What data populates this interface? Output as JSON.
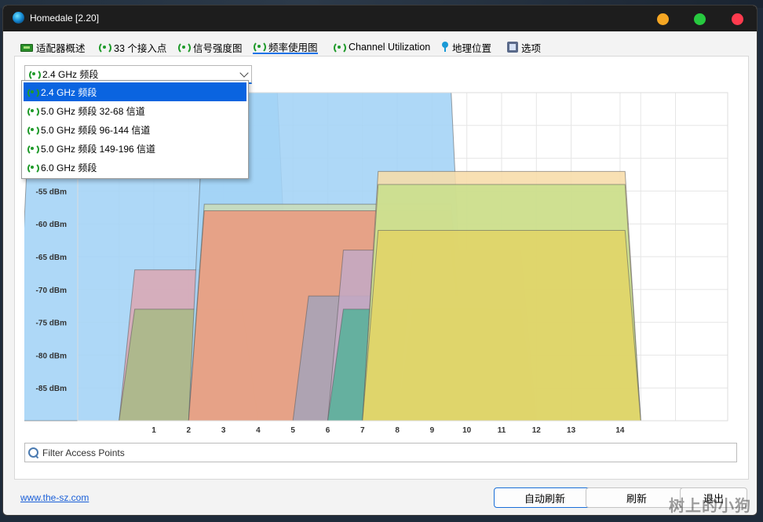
{
  "window": {
    "title": "Homedale [2.20]"
  },
  "tabs": [
    {
      "label": "适配器概述",
      "icon": "adapter-icon"
    },
    {
      "label": "33 个接入点",
      "icon": "signal-icon"
    },
    {
      "label": "信号强度图",
      "icon": "signal-icon"
    },
    {
      "label": "频率使用图",
      "icon": "signal-icon",
      "active": true
    },
    {
      "label": "Channel Utilization",
      "icon": "signal-icon"
    },
    {
      "label": "地理位置",
      "icon": "location-pin-icon"
    },
    {
      "label": "选项",
      "icon": "options-icon"
    }
  ],
  "band_select": {
    "value": "2.4 GHz 频段",
    "options": [
      "2.4 GHz 频段",
      "5.0 GHz 频段 32-68 信道",
      "5.0 GHz 频段 96-144 信道",
      "5.0 GHz 频段 149-196 信道",
      "6.0 GHz 频段"
    ]
  },
  "filter": {
    "placeholder": "Filter Access Points"
  },
  "footer": {
    "link": "www.the-sz.com",
    "auto_refresh": "自动刷新",
    "refresh": "刷新",
    "exit": "退出"
  },
  "watermark": "树上的小狗",
  "chart_data": {
    "type": "area",
    "x_label": "",
    "y_label": "",
    "x_ticks": [
      1,
      2,
      3,
      4,
      5,
      6,
      7,
      8,
      9,
      10,
      11,
      12,
      13,
      14
    ],
    "x_range": [
      -1,
      15
    ],
    "y_ticks": [
      -55,
      -60,
      -65,
      -70,
      -75,
      -80,
      -85
    ],
    "y_tick_labels": [
      "-55 dBm",
      "-60 dBm",
      "-65 dBm",
      "-70 dBm",
      "-75 dBm",
      "-80 dBm",
      "-85 dBm"
    ],
    "y_range": [
      -90,
      -40
    ],
    "grid": true,
    "series": [
      {
        "center": 1,
        "width_mhz": 40,
        "signal": -40,
        "color": "#a3d3f6"
      },
      {
        "center": 2,
        "width_mhz": 20,
        "signal": -67,
        "color": "#dba7b4"
      },
      {
        "center": 2,
        "width_mhz": 20,
        "signal": -73,
        "color": "#a9ba86"
      },
      {
        "center": 6,
        "width_mhz": 40,
        "signal": -40,
        "color": "#a3d3f6"
      },
      {
        "center": 6,
        "width_mhz": 40,
        "signal": -57,
        "color": "#c9dcb9"
      },
      {
        "center": 6,
        "width_mhz": 40,
        "signal": -58,
        "color": "#ea9a7e"
      },
      {
        "center": 7,
        "width_mhz": 20,
        "signal": -71,
        "color": "#a6a3b8"
      },
      {
        "center": 8,
        "width_mhz": 20,
        "signal": -64,
        "color": "#c4a8c4"
      },
      {
        "center": 9,
        "width_mhz": 20,
        "signal": -71,
        "color": "#5cc6c0"
      },
      {
        "center": 8,
        "width_mhz": 20,
        "signal": -73,
        "color": "#58b09a"
      },
      {
        "center": 10,
        "width_mhz": 20,
        "signal": -64,
        "color": "#86c0a0"
      },
      {
        "center": 10,
        "width_mhz": 20,
        "signal": -73,
        "color": "#70c88c"
      },
      {
        "center": 11,
        "width_mhz": 40,
        "signal": -52,
        "color": "#f7dca8"
      },
      {
        "center": 11,
        "width_mhz": 40,
        "signal": -54,
        "color": "#c8df8c"
      },
      {
        "center": 11,
        "width_mhz": 40,
        "signal": -61,
        "color": "#e1d466"
      }
    ]
  }
}
